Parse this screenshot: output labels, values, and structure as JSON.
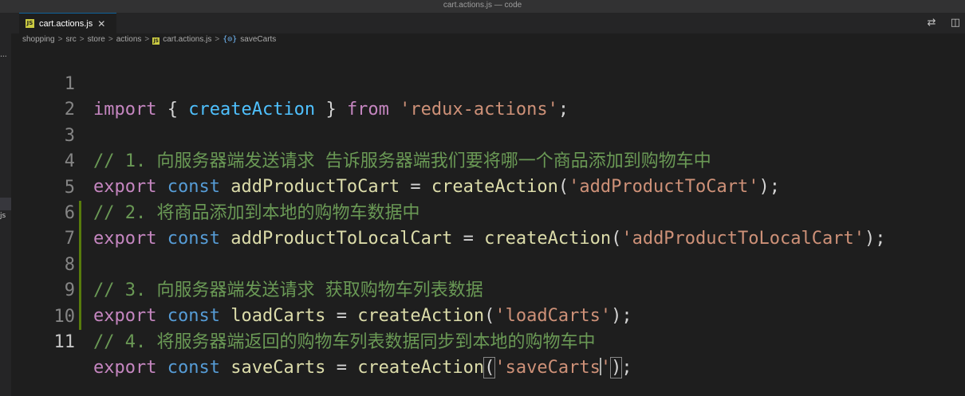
{
  "window": {
    "title": "cart.actions.js — code"
  },
  "left_panel": {
    "fragment_top": "...",
    "fragment_mid": "js"
  },
  "tab": {
    "badge": "JS",
    "label": "cart.actions.js",
    "close": "✕"
  },
  "toolbar": {
    "compare_icon": "⇄",
    "split_icon": "◫"
  },
  "breadcrumb": {
    "items": [
      "shopping",
      "src",
      "store",
      "actions",
      "cart.actions.js",
      "saveCarts"
    ],
    "separator": ">",
    "symbol_glyph": "{⊙}"
  },
  "editor": {
    "lines": [
      {
        "n": "1"
      },
      {
        "n": "2"
      },
      {
        "n": "3",
        "comment": "// 1. 向服务器端发送请求 告诉服务器端我们要将哪一个商品添加到购物车中"
      },
      {
        "n": "4",
        "name": "addProductToCart",
        "arg": "'addProductToCart'"
      },
      {
        "n": "5",
        "comment": "// 2. 将商品添加到本地的购物车数据中"
      },
      {
        "n": "6",
        "name": "addProductToLocalCart",
        "arg": "'addProductToLocalCart'"
      },
      {
        "n": "7"
      },
      {
        "n": "8",
        "comment": "// 3. 向服务器端发送请求 获取购物车列表数据"
      },
      {
        "n": "9",
        "name": "loadCarts",
        "arg": "'loadCarts'"
      },
      {
        "n": "10",
        "comment": "// 4. 将服务器端返回的购物车列表数据同步到本地的购物车中"
      },
      {
        "n": "11",
        "name": "saveCarts",
        "arg_head": "'saveCarts",
        "arg_tail": "'"
      }
    ],
    "import": {
      "kw": "import",
      "open": "{",
      "name": "createAction",
      "close": "}",
      "from": "from",
      "module": "'redux-actions'",
      "semi": ";"
    },
    "tokens": {
      "export": "export",
      "const": "const",
      "eq": "=",
      "call": "createAction",
      "paren_open": "(",
      "paren_close": ")",
      "semi": ";"
    }
  }
}
